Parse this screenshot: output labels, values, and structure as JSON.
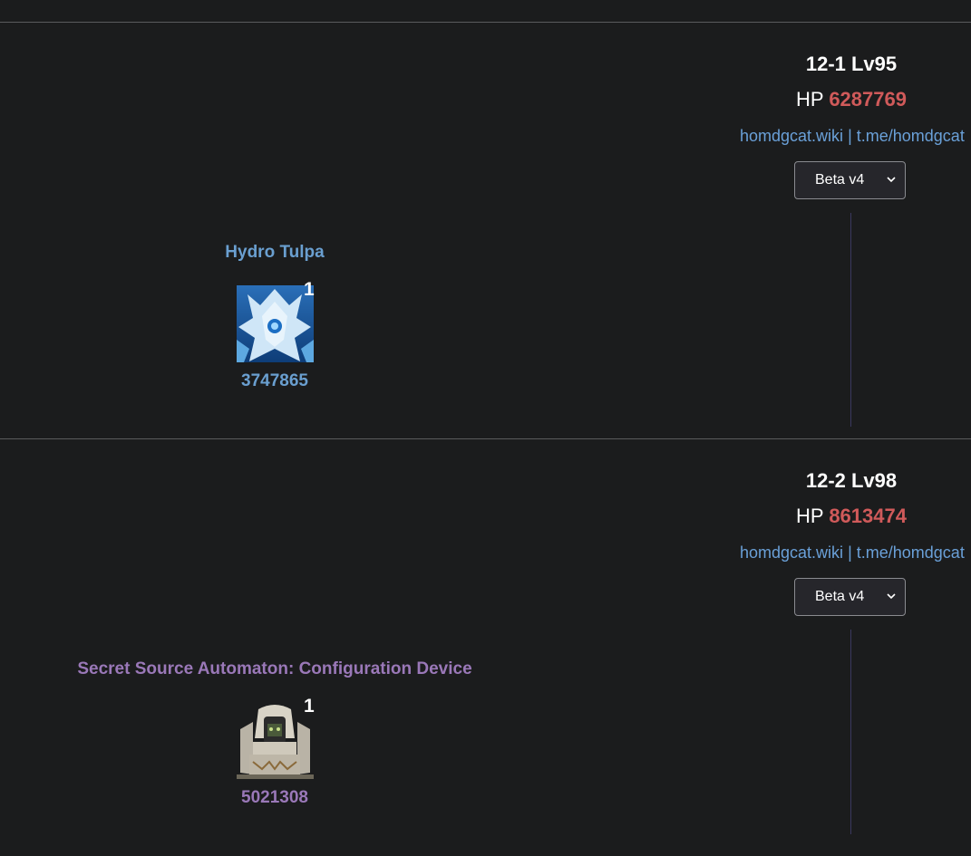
{
  "stages": [
    {
      "title": "12-1 Lv95",
      "hp_label": "HP",
      "hp_value": "6287769",
      "link_wiki": "homdgcat.wiki",
      "link_sep": "|",
      "link_tg": "t.me/homdgcat",
      "version": "Beta v4",
      "enemy": {
        "name": "Hydro Tulpa",
        "count": "1",
        "hp": "3747865",
        "color": "#6a9fd0",
        "icon": "hydro-tulpa-portrait"
      }
    },
    {
      "title": "12-2 Lv98",
      "hp_label": "HP",
      "hp_value": "8613474",
      "link_wiki": "homdgcat.wiki",
      "link_sep": "|",
      "link_tg": "t.me/homdgcat",
      "version": "Beta v4",
      "enemy": {
        "name": "Secret Source Automaton: Configuration Device",
        "count": "1",
        "hp": "5021308",
        "color": "#9a78b8",
        "icon": "automaton-portrait"
      }
    }
  ],
  "colors": {
    "background": "#1b1c1d",
    "hp_value": "#d05a5a",
    "link": "#6aa0d8",
    "divider": "#5a5b5d"
  }
}
